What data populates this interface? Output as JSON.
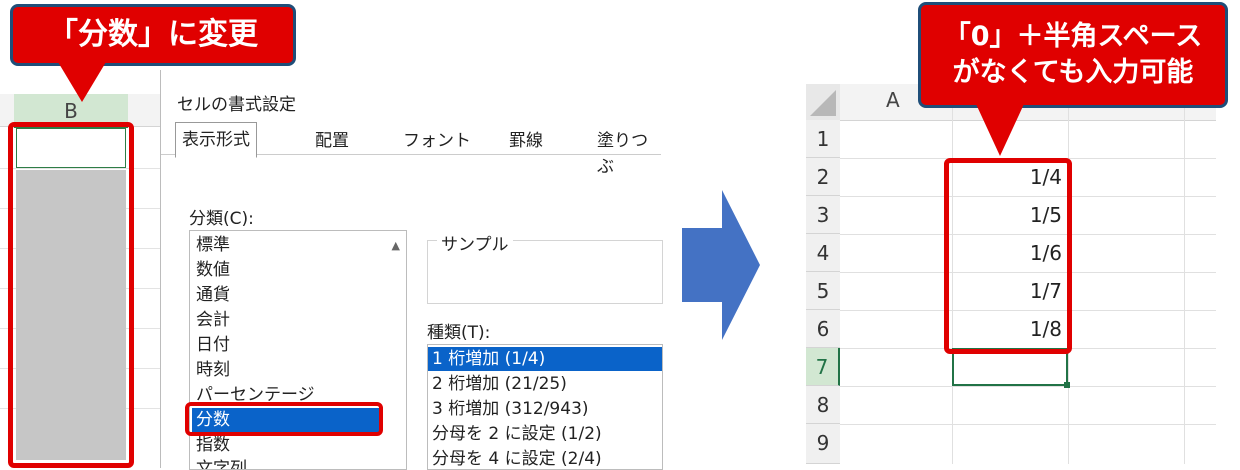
{
  "callouts": {
    "left": "「分数」に変更",
    "right_line1": "「0」＋半角スペース",
    "right_line2": "がなくても入力可能"
  },
  "left_sheet": {
    "column_label": "B"
  },
  "dialog": {
    "title": "セルの書式設定",
    "tabs": [
      "表示形式",
      "配置",
      "フォント",
      "罫線",
      "塗りつぶ"
    ],
    "category_label": "分類(C):",
    "categories": [
      "標準",
      "数値",
      "通貨",
      "会計",
      "日付",
      "時刻",
      "パーセンテージ",
      "分数",
      "指数",
      "文字列"
    ],
    "selected_category": "分数",
    "sample_label": "サンプル",
    "type_label": "種類(T):",
    "types": [
      "1 桁増加 (1/4)",
      "2 桁増加 (21/25)",
      "3 桁増加 (312/943)",
      "分母を 2 に設定 (1/2)",
      "分母を 4 に設定 (2/4)"
    ],
    "selected_type": "1 桁増加 (1/4)"
  },
  "right_sheet": {
    "column_label": "A",
    "rows": [
      "1",
      "2",
      "3",
      "4",
      "5",
      "6",
      "7",
      "8",
      "9"
    ],
    "values": [
      "",
      "1/4",
      "1/5",
      "1/6",
      "1/7",
      "1/8",
      "",
      "",
      ""
    ]
  },
  "colors": {
    "accent_red": "#e00000",
    "selection_blue": "#0a63c9",
    "arrow_blue": "#4472c4",
    "excel_green": "#217346"
  }
}
